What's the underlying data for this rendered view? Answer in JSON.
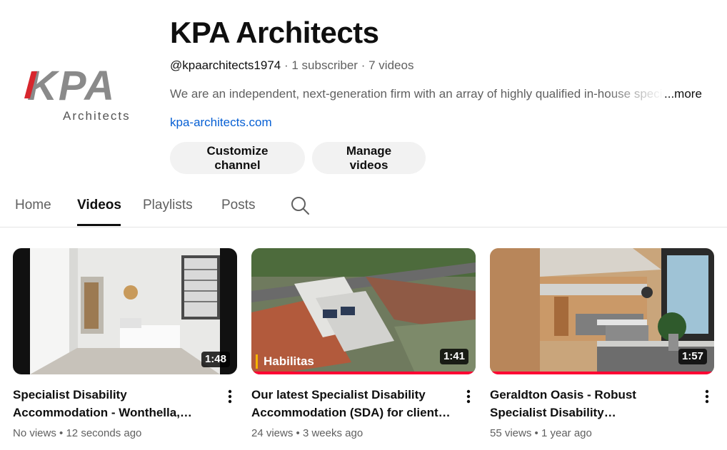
{
  "channel": {
    "name": "KPA Architects",
    "handle": "@kpaarchitects1974",
    "subscribers": "1 subscriber",
    "video_count": "7 videos",
    "separator": "·",
    "description": "We are an independent, next-generation firm with an array of highly qualified in-house specialists",
    "more_label": "...more",
    "link": "kpa-architects.com",
    "logo_text": "KPA",
    "logo_subtext": "Architects",
    "logo_accent_color": "#d7262d"
  },
  "buttons": {
    "customize": "Customize channel",
    "manage": "Manage videos"
  },
  "tabs": [
    {
      "label": "Home"
    },
    {
      "label": "Videos"
    },
    {
      "label": "Playlists"
    },
    {
      "label": "Posts"
    }
  ],
  "active_tab": "Videos",
  "videos": [
    {
      "title": "Specialist Disability Accommodation - Wonthella, Geraldton",
      "duration": "1:48",
      "views": "No views",
      "age": "12 seconds ago",
      "dot": "•",
      "progress": 0
    },
    {
      "title": "Our latest Specialist Disability Accommodation (SDA) for clients in Perth",
      "duration": "1:41",
      "views": "24 views",
      "age": "3 weeks ago",
      "dot": "•",
      "watermark": "Habilitas",
      "progress": 1.0
    },
    {
      "title": "Geraldton Oasis - Robust Specialist Disability Accommodation (SDA)",
      "duration": "1:57",
      "views": "55 views",
      "age": "1 year ago",
      "dot": "•",
      "progress": 1.0
    }
  ],
  "icons": {
    "search": "search-icon",
    "more": "more-vert-icon"
  },
  "colors": {
    "link": "#065fd4",
    "button_bg": "#f2f2f2",
    "progress": "#ff0033",
    "muted_text": "#606060"
  }
}
